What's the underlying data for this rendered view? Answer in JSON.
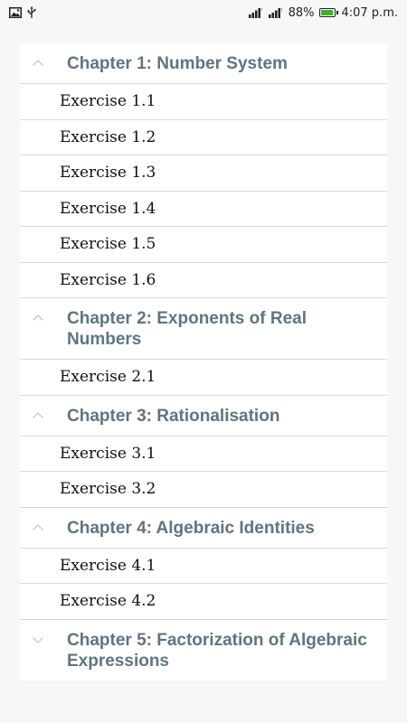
{
  "status_bar": {
    "battery_percent": "88%",
    "time": "4:07 p.m.",
    "battery_level": 0.88,
    "battery_color": "#3cb521",
    "icons": [
      "image-icon",
      "usb-icon",
      "signal-icon",
      "signal-icon",
      "battery-icon"
    ]
  },
  "colors": {
    "chapter_title": "#5f7580",
    "divider": "#d9d9d9",
    "background": "#f7f7f7"
  },
  "chapters": [
    {
      "title": "Chapter 1: Number System",
      "expanded": true,
      "exercises": [
        "Exercise 1.1",
        "Exercise 1.2",
        "Exercise 1.3",
        "Exercise 1.4",
        "Exercise 1.5",
        "Exercise 1.6"
      ]
    },
    {
      "title": "Chapter 2: Exponents of Real Numbers",
      "expanded": true,
      "exercises": [
        "Exercise 2.1"
      ]
    },
    {
      "title": "Chapter 3: Rationalisation",
      "expanded": true,
      "exercises": [
        "Exercise 3.1",
        "Exercise 3.2"
      ]
    },
    {
      "title": "Chapter 4: Algebraic Identities",
      "expanded": true,
      "exercises": [
        "Exercise 4.1",
        "Exercise 4.2"
      ]
    },
    {
      "title": "Chapter 5: Factorization of Algebraic Expressions",
      "expanded": false,
      "exercises": []
    }
  ]
}
